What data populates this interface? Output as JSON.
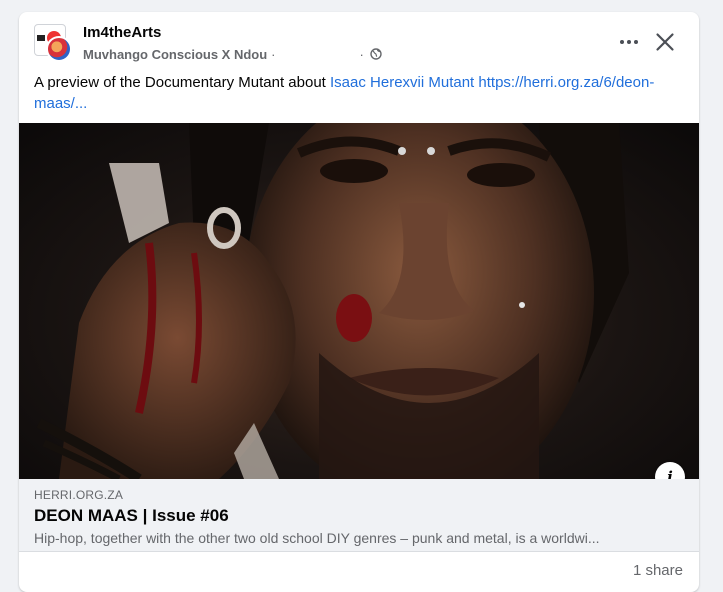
{
  "post": {
    "page_name": "Im4theArts",
    "author": "Muvhango Conscious X Ndou",
    "author_sep": "·",
    "time_sep": "·",
    "text_prefix": "A preview of the Documentary Mutant about ",
    "text_link_name": "Isaac Herexvii Mutant",
    "text_link_url": "https://herri.org.za/6/deon-maas/...",
    "privacy_icon": "globe-icon",
    "more_icon": "more-icon",
    "close_icon": "close-icon"
  },
  "media": {
    "alt": "",
    "info_glyph": "i"
  },
  "link_preview": {
    "domain": "HERRI.ORG.ZA",
    "title": "DEON MAAS | Issue #06",
    "description": "Hip-hop, together with the other two old school DIY genres – punk and metal, is a worldwi..."
  },
  "footer": {
    "shares": "1 share"
  },
  "colors": {
    "link": "#216fdb",
    "secondary_text": "#65676b",
    "background": "#f0f2f5"
  }
}
